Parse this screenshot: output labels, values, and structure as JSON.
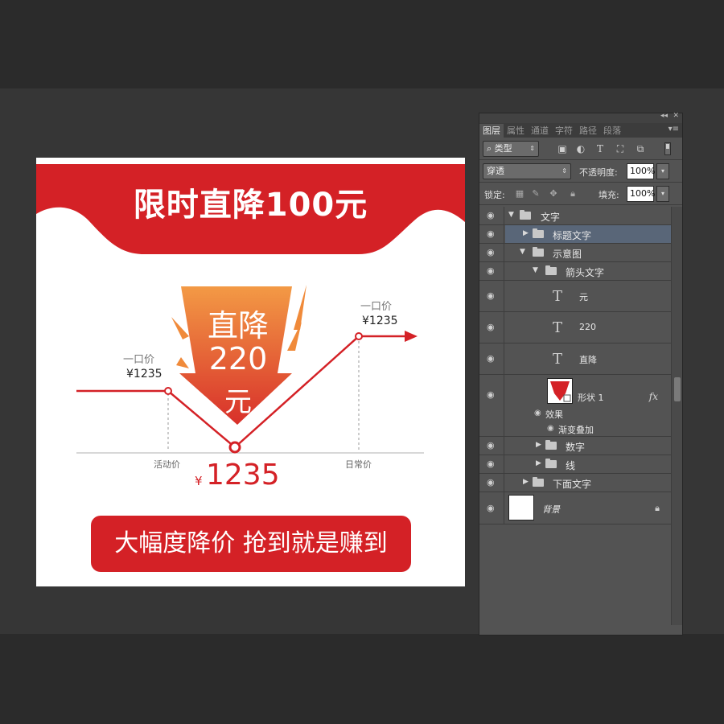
{
  "canvas": {
    "headline": "限时直降100元",
    "arrow": {
      "line1": "直降",
      "line2": "220",
      "line3": "元"
    },
    "left_price": {
      "label": "一口价",
      "value": "¥1235"
    },
    "right_price": {
      "label": "一口价",
      "value": "¥1235"
    },
    "axis_labels": {
      "left": "活动价",
      "right": "日常价"
    },
    "current_price": {
      "symbol": "¥",
      "value": "1235"
    },
    "cta": "大幅度降价 抢到就是赚到",
    "colors": {
      "red": "#d42126",
      "orange": "#f08a3a",
      "white": "#ffffff"
    }
  },
  "panel": {
    "collapse_glyph": "◂◂",
    "close_glyph": "✕",
    "tabs": [
      "图层",
      "属性",
      "通道",
      "字符",
      "路径",
      "段落"
    ],
    "active_tab": "图层",
    "menu_glyph": "▾≡",
    "filter": {
      "icon": "search-icon",
      "label": "类型"
    },
    "blend_mode": "穿透",
    "opacity_label": "不透明度:",
    "opacity_value": "100%",
    "lock_label": "锁定:",
    "fill_label": "填充:",
    "fill_value": "100%",
    "layers": [
      {
        "name": "文字",
        "kind": "group",
        "expanded": true
      },
      {
        "name": "标题文字",
        "kind": "group",
        "expanded": false,
        "selected": true
      },
      {
        "name": "示意图",
        "kind": "group",
        "expanded": true
      },
      {
        "name": "箭头文字",
        "kind": "group",
        "expanded": true
      },
      {
        "name": "元",
        "kind": "text"
      },
      {
        "name": "220",
        "kind": "text"
      },
      {
        "name": "直降",
        "kind": "text"
      },
      {
        "name": "形状 1",
        "kind": "shape",
        "fx": "fx"
      },
      {
        "name": "效果",
        "kind": "effect"
      },
      {
        "name": "渐变叠加",
        "kind": "effect"
      },
      {
        "name": "数字",
        "kind": "group",
        "expanded": false
      },
      {
        "name": "线",
        "kind": "group",
        "expanded": false
      },
      {
        "name": "下面文字",
        "kind": "group",
        "expanded": false
      },
      {
        "name": "背景",
        "kind": "background"
      }
    ]
  }
}
